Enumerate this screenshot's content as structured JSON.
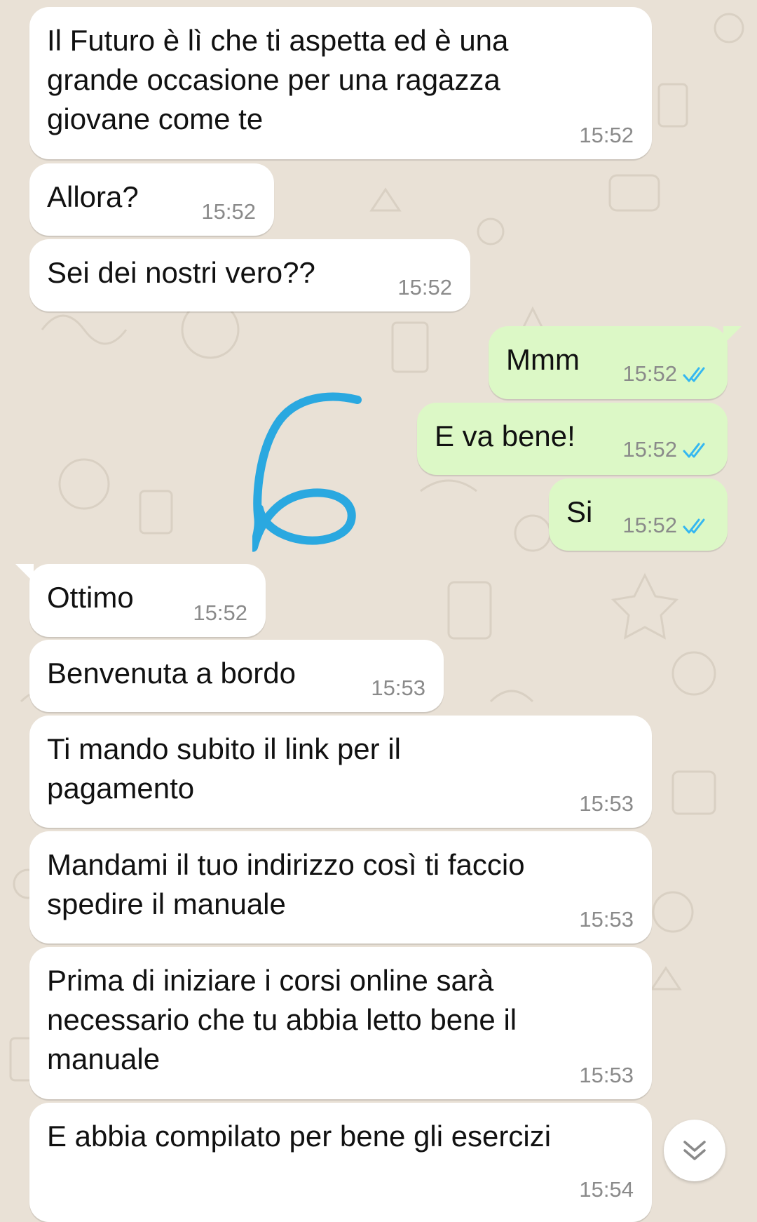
{
  "messages": [
    {
      "dir": "in",
      "text": "Il Futuro è lì che ti aspetta ed è una\ngrande occasione per una ragazza\ngiovane come te",
      "time": "15:52"
    },
    {
      "dir": "in",
      "text": "Allora?",
      "time": "15:52"
    },
    {
      "dir": "in",
      "text": "Sei dei nostri vero??",
      "time": "15:52"
    },
    {
      "dir": "out",
      "text": "Mmm",
      "time": "15:52",
      "status": "read"
    },
    {
      "dir": "out",
      "text": "E va bene!",
      "time": "15:52",
      "status": "read"
    },
    {
      "dir": "out",
      "text": "Si",
      "time": "15:52",
      "status": "read"
    },
    {
      "dir": "in",
      "text": "Ottimo",
      "time": "15:52"
    },
    {
      "dir": "in",
      "text": "Benvenuta a bordo",
      "time": "15:53"
    },
    {
      "dir": "in",
      "text": "Ti mando subito il link per il\npagamento",
      "time": "15:53"
    },
    {
      "dir": "in",
      "text": "Mandami il tuo indirizzo così ti faccio\nspedire il manuale",
      "time": "15:53"
    },
    {
      "dir": "in",
      "text": "Prima di iniziare i corsi online sarà\nnecessario che tu abbia letto bene il\nmanuale",
      "time": "15:53"
    },
    {
      "dir": "in",
      "text": "E abbia compilato per bene gli esercizi",
      "time": "15:54"
    }
  ],
  "colors": {
    "background": "#e9e1d6",
    "incoming_bubble": "#ffffff",
    "outgoing_bubble": "#dcf8c6",
    "read_ticks": "#34b7f1",
    "annotation": "#2aa8e0"
  },
  "icons": {
    "read_receipt": "double-check-icon",
    "scroll_down": "double-chevron-down-icon"
  }
}
